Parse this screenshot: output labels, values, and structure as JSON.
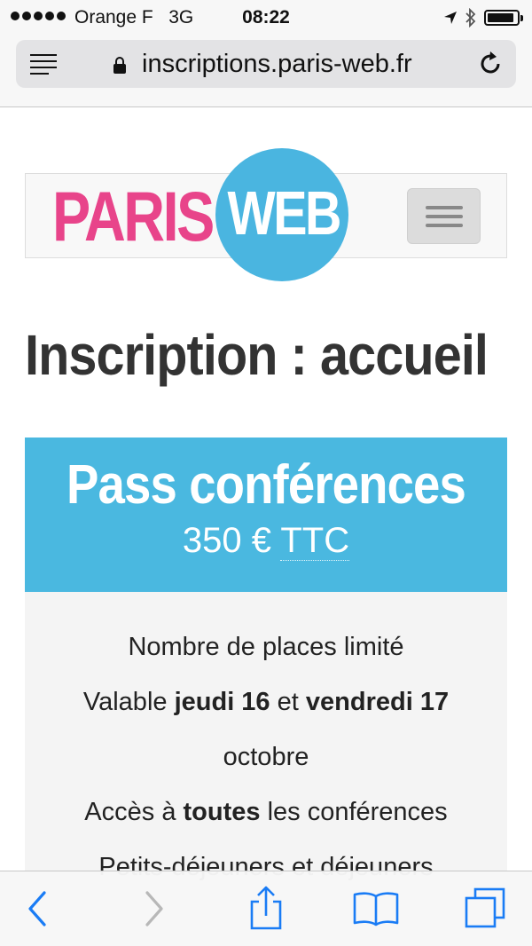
{
  "status_bar": {
    "carrier": "Orange F",
    "network": "3G",
    "time": "08:22",
    "battery_level": 0.9
  },
  "address_bar": {
    "url": "inscriptions.paris-web.fr"
  },
  "site": {
    "logo_left": "PARIS",
    "logo_right": "WEB",
    "brand_colors": {
      "pink": "#e8448a",
      "blue": "#4ab5e0"
    }
  },
  "page": {
    "title": "Inscription : accueil"
  },
  "pass": {
    "title": "Pass conférences",
    "price": "350 €",
    "tax": "TTC",
    "features": [
      {
        "text": "Nombre de places limité"
      },
      {
        "a": "Valable ",
        "b1": "jeudi 16",
        "c": " et ",
        "b2": "vendredi 17"
      },
      {
        "text": "octobre"
      },
      {
        "a": "Accès à ",
        "b1": "toutes",
        "c": " les conférences"
      },
      {
        "text": "Petits-déjeuners et déjeuners"
      }
    ]
  },
  "toolbar": {
    "icons": [
      "back-icon",
      "forward-icon",
      "share-icon",
      "bookmarks-icon",
      "tabs-icon"
    ]
  }
}
